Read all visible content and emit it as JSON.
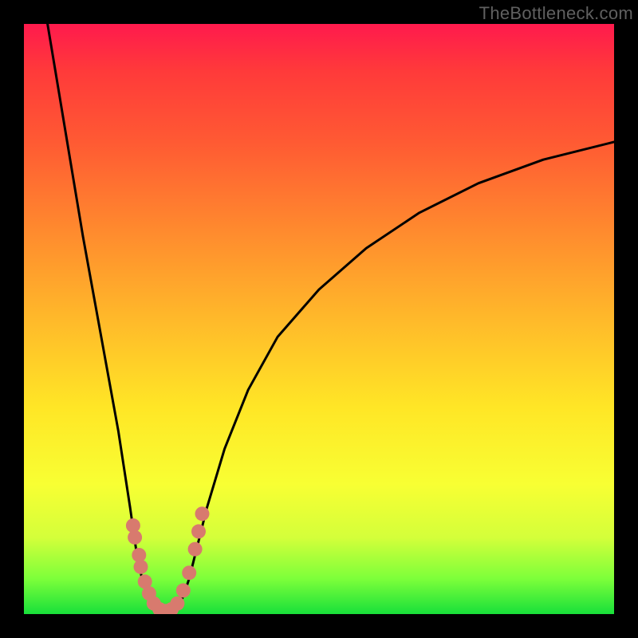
{
  "watermark": "TheBottleneck.com",
  "colors": {
    "frame": "#000000",
    "curve": "#000000",
    "marker": "#d87a6e",
    "gradient_stops": [
      "#ff1a4d",
      "#ff3a3a",
      "#ff5a33",
      "#ff8a2e",
      "#ffb92a",
      "#ffe626",
      "#f8ff33",
      "#d4ff3a",
      "#7dff3a",
      "#18e03a"
    ]
  },
  "chart_data": {
    "type": "line",
    "title": "",
    "xlabel": "",
    "ylabel": "",
    "xlim": [
      0,
      100
    ],
    "ylim": [
      0,
      100
    ],
    "note": "y read as height from bottom (0=bottom/green, 100=top/red). Values estimated from pixel positions on an unlabeled plot.",
    "series": [
      {
        "name": "left-branch",
        "x": [
          4,
          6,
          8,
          10,
          12,
          14,
          16,
          18,
          19,
          20,
          21,
          22
        ],
        "y": [
          100,
          88,
          76,
          64,
          53,
          42,
          31,
          18,
          11,
          6,
          3,
          1
        ]
      },
      {
        "name": "valley-floor",
        "x": [
          22,
          23,
          24,
          25,
          26
        ],
        "y": [
          1,
          0.5,
          0.4,
          0.5,
          1
        ]
      },
      {
        "name": "right-branch",
        "x": [
          26,
          27,
          28,
          29,
          31,
          34,
          38,
          43,
          50,
          58,
          67,
          77,
          88,
          100
        ],
        "y": [
          1,
          3,
          6,
          10,
          18,
          28,
          38,
          47,
          55,
          62,
          68,
          73,
          77,
          80
        ]
      }
    ],
    "markers": {
      "name": "salmon-dots",
      "comment": "Clustered points near the bottom of the V on both walls and floor.",
      "points": [
        {
          "x": 18.5,
          "y": 15
        },
        {
          "x": 18.8,
          "y": 13
        },
        {
          "x": 19.5,
          "y": 10
        },
        {
          "x": 19.8,
          "y": 8
        },
        {
          "x": 20.5,
          "y": 5.5
        },
        {
          "x": 21.2,
          "y": 3.5
        },
        {
          "x": 22.0,
          "y": 1.8
        },
        {
          "x": 23.0,
          "y": 0.8
        },
        {
          "x": 24.0,
          "y": 0.5
        },
        {
          "x": 25.0,
          "y": 0.8
        },
        {
          "x": 26.0,
          "y": 1.8
        },
        {
          "x": 27.0,
          "y": 4
        },
        {
          "x": 28.0,
          "y": 7
        },
        {
          "x": 29.0,
          "y": 11
        },
        {
          "x": 29.6,
          "y": 14
        },
        {
          "x": 30.2,
          "y": 17
        }
      ]
    }
  }
}
